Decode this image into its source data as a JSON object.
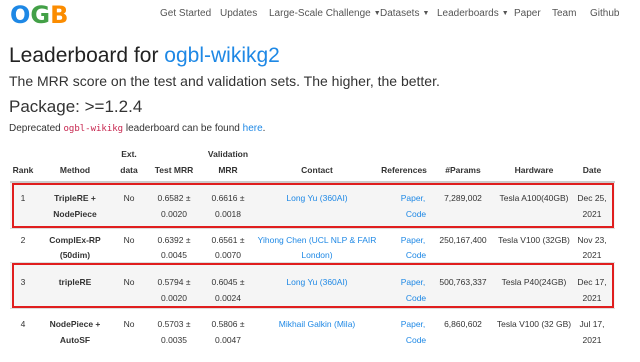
{
  "navbar": {
    "logo": {
      "o": "O",
      "g": "G",
      "b": "B"
    },
    "items": [
      {
        "label": "Get Started",
        "dropdown": false
      },
      {
        "label": "Updates",
        "dropdown": false
      },
      {
        "label": "Large-Scale Challenge",
        "dropdown": true
      },
      {
        "label": "Datasets",
        "dropdown": true
      },
      {
        "label": "Leaderboards",
        "dropdown": true
      },
      {
        "label": "Paper",
        "dropdown": false
      },
      {
        "label": "Team",
        "dropdown": false
      },
      {
        "label": "Github",
        "dropdown": false
      }
    ]
  },
  "page": {
    "title_prefix": "Leaderboard for",
    "title_link": "ogbl-wikikg2",
    "subtitle": "The MRR score on the test and validation sets. The higher, the better.",
    "package": "Package: >=1.2.4",
    "deprecated_prefix": "Deprecated",
    "deprecated_code": "ogbl-wikikg",
    "deprecated_middle": "leaderboard can be found",
    "deprecated_link": "here",
    "deprecated_suffix": "."
  },
  "table": {
    "headers": {
      "rank": "Rank",
      "method": "Method",
      "ext_1": "Ext.",
      "ext_2": "data",
      "test": "Test MRR",
      "val_1": "Validation",
      "val_2": "MRR",
      "contact": "Contact",
      "references": "References",
      "params": "#Params",
      "hardware": "Hardware",
      "date": "Date"
    },
    "rows": [
      {
        "rank": "1",
        "method_1": "TripleRE +",
        "method_2": "NodePiece",
        "ext": "No",
        "test_1": "0.6582 ±",
        "test_2": "0.0020",
        "val_1": "0.6616 ±",
        "val_2": "0.0018",
        "contact_1": "Long Yu (360AI)",
        "contact_2": "",
        "ref_1": "Paper,",
        "ref_2": "Code",
        "params": "7,289,002",
        "hardware": "Tesla A100(40GB)",
        "date_1": "Dec 25,",
        "date_2": "2021"
      },
      {
        "rank": "2",
        "method_1": "ComplEx-RP",
        "method_2": "(50dim)",
        "ext": "No",
        "test_1": "0.6392 ±",
        "test_2": "0.0045",
        "val_1": "0.6561 ±",
        "val_2": "0.0070",
        "contact_1": "Yihong Chen (UCL NLP & FAIR",
        "contact_2": "London)",
        "ref_1": "Paper,",
        "ref_2": "Code",
        "params": "250,167,400",
        "hardware": "Tesla V100 (32GB)",
        "date_1": "Nov 23,",
        "date_2": "2021"
      },
      {
        "rank": "3",
        "method_1": "tripleRE",
        "method_2": "",
        "ext": "No",
        "test_1": "0.5794 ±",
        "test_2": "0.0020",
        "val_1": "0.6045 ±",
        "val_2": "0.0024",
        "contact_1": "Long Yu (360AI)",
        "contact_2": "",
        "ref_1": "Paper,",
        "ref_2": "Code",
        "params": "500,763,337",
        "hardware": "Tesla P40(24GB)",
        "date_1": "Dec 17,",
        "date_2": "2021"
      },
      {
        "rank": "4",
        "method_1": "NodePiece +",
        "method_2": "AutoSF",
        "ext": "No",
        "test_1": "0.5703 ±",
        "test_2": "0.0035",
        "val_1": "0.5806 ±",
        "val_2": "0.0047",
        "contact_1": "Mikhail Galkin (Mila)",
        "contact_2": "",
        "ref_1": "Paper,",
        "ref_2": "Code",
        "params": "6,860,602",
        "hardware": "Tesla V100 (32 GB)",
        "date_1": "Jul 17,",
        "date_2": "2021"
      }
    ]
  },
  "colors": {
    "link": "#1e88e5",
    "highlight": "#e01e1e",
    "row_alt": "#f5f5f5"
  }
}
